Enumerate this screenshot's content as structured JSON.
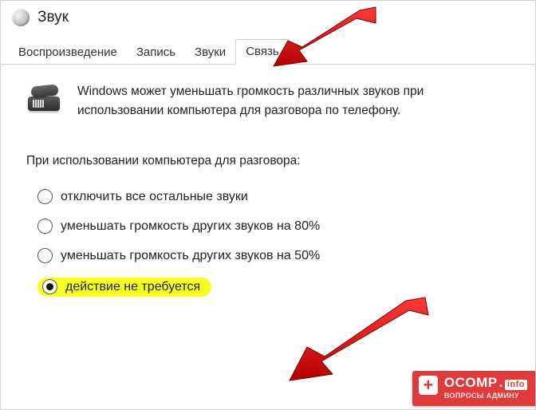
{
  "window": {
    "title": "Звук"
  },
  "tabs": [
    {
      "label": "Воспроизведение",
      "active": false
    },
    {
      "label": "Запись",
      "active": false
    },
    {
      "label": "Звуки",
      "active": false
    },
    {
      "label": "Связь",
      "active": true
    }
  ],
  "info_text": "Windows может уменьшать громкость различных звуков при использовании компьютера для разговора по телефону.",
  "section_label": "При использовании компьютера для разговора:",
  "radios": [
    {
      "label": "отключить все остальные звуки",
      "checked": false
    },
    {
      "label": "уменьшать громкость других звуков на 80%",
      "checked": false
    },
    {
      "label": "уменьшать громкость других звуков на 50%",
      "checked": false
    },
    {
      "label": "действие не требуется",
      "checked": true
    }
  ],
  "watermark": {
    "brand": "OCOMP",
    "tld": "info",
    "tagline": "ВОПРОСЫ АДМИНУ"
  }
}
